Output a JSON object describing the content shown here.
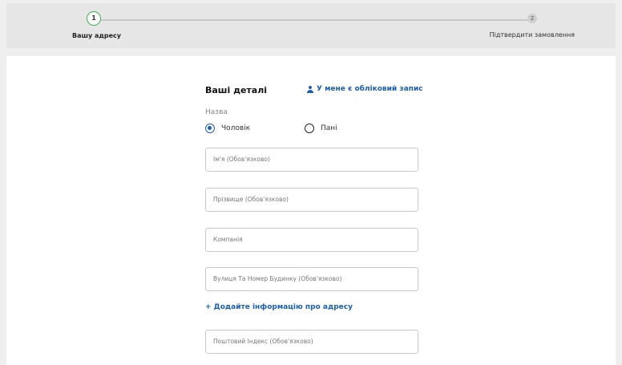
{
  "stepper": {
    "steps": [
      {
        "number": "1",
        "label": "Вашу адресу"
      },
      {
        "number": "2",
        "label": "Підтвердити замовлення"
      }
    ],
    "colors": {
      "active": "#3bb44a",
      "inactive": "#cfcfcf"
    }
  },
  "form": {
    "title": "Ваші деталі",
    "account_link": "У мене є обліковий запис",
    "account_icon": "person-icon",
    "name_label": "Назва",
    "gender": {
      "options": [
        "Чоловік",
        "Пані"
      ],
      "selected": "Чоловік"
    },
    "fields": {
      "first_name": "Ім'я (Обов'язково)",
      "last_name": "Прізвище (Обов'язково)",
      "company": "Компанія",
      "street": "Вулиця Та Номер Будинку (Обов'язково)",
      "postcode": "Поштовий Індекс (Обов'язково)"
    },
    "add_address_link": "+ Додайте інформацію про адресу"
  },
  "colors": {
    "link": "#1a5fb4",
    "background": "#efefef",
    "panel": "#ffffff"
  }
}
